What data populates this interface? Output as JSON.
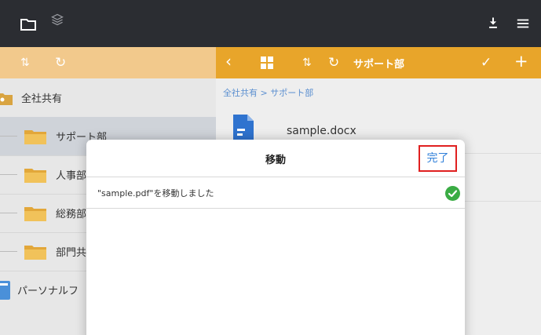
{
  "topbar": {
    "left_icons": [
      "folder-icon",
      "layers-icon"
    ],
    "right_icons": [
      "download-icon",
      "menu-icon"
    ]
  },
  "toolbar": {
    "left_icons": [
      "sort-icon",
      "refresh-icon"
    ],
    "right_icons": [
      "back-chevron-icon",
      "grid-view-icon",
      "sort-icon",
      "refresh-icon",
      "checkmark-icon",
      "plus-icon"
    ],
    "title": "サポート部"
  },
  "sidebar": {
    "items": [
      {
        "label": "全社共有",
        "icon": "group-folder-icon"
      },
      {
        "label": "サポート部",
        "icon": "folder-icon",
        "selected": true
      },
      {
        "label": "人事部",
        "icon": "folder-icon"
      },
      {
        "label": "総務部",
        "icon": "folder-icon"
      },
      {
        "label": "部門共",
        "icon": "folder-icon"
      },
      {
        "label": "パーソナルフ",
        "icon": "personal-folder-icon"
      }
    ]
  },
  "main": {
    "breadcrumb": "全社共有 > サポート部",
    "files": [
      {
        "name": "sample.docx",
        "icon": "docx-file-icon"
      }
    ]
  },
  "modal": {
    "title": "移動",
    "done_label": "完了",
    "message": "\"sample.pdf\"を移動しました",
    "status_icon": "success-check-icon"
  },
  "colors": {
    "topbar": "#2b2d32",
    "toolbar_left": "#f2c98c",
    "toolbar_right": "#e8a52a",
    "link": "#2f7fd9",
    "highlight_border": "#e02020",
    "success": "#3aac44"
  }
}
